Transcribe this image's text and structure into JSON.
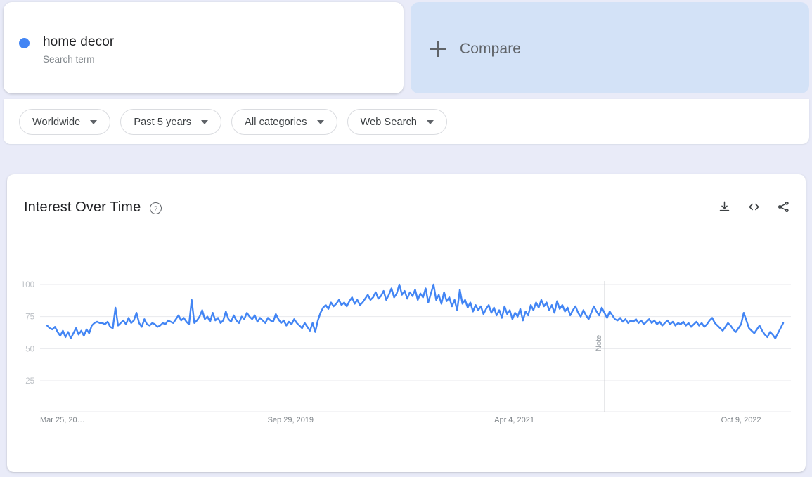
{
  "search_term_card": {
    "dot_color": "#4285f4",
    "term": "home decor",
    "subtitle": "Search term"
  },
  "compare_card": {
    "label": "Compare",
    "background": "#d3e2f7"
  },
  "filters": [
    {
      "label": "Worldwide"
    },
    {
      "label": "Past 5 years"
    },
    {
      "label": "All categories"
    },
    {
      "label": "Web Search"
    }
  ],
  "chart_panel": {
    "title": "Interest Over Time",
    "help_glyph": "?",
    "actions": [
      {
        "name": "download-icon"
      },
      {
        "name": "embed-icon"
      },
      {
        "name": "share-icon"
      }
    ]
  },
  "chart_data": {
    "type": "line",
    "title": "Interest Over Time",
    "xlabel": "",
    "ylabel": "",
    "ylim": [
      0,
      100
    ],
    "yticks": [
      25,
      50,
      75,
      100
    ],
    "ytick_labels": [
      "25",
      "50",
      "75",
      "100"
    ],
    "grid": true,
    "legend": false,
    "line_color": "#4285f4",
    "series_name": "home decor",
    "xtick_labels": [
      "Mar 25, 20…",
      "Sep 29, 2019",
      "Apr 4, 2021",
      "Oct 9, 2022"
    ],
    "xtick_positions_pct": [
      0.0,
      0.303,
      0.605,
      0.907
    ],
    "annotations": [
      {
        "type": "vertical-line",
        "label": "Note",
        "position_pct": 0.752
      }
    ],
    "values": [
      68,
      66,
      65,
      67,
      63,
      60,
      64,
      59,
      63,
      58,
      62,
      66,
      61,
      64,
      60,
      65,
      62,
      68,
      70,
      71,
      70,
      70,
      69,
      71,
      67,
      66,
      82,
      68,
      70,
      72,
      69,
      74,
      70,
      72,
      78,
      70,
      67,
      73,
      69,
      68,
      70,
      69,
      67,
      68,
      70,
      69,
      72,
      71,
      70,
      73,
      76,
      72,
      74,
      71,
      69,
      88,
      70,
      72,
      75,
      80,
      73,
      75,
      71,
      78,
      72,
      74,
      70,
      72,
      79,
      73,
      71,
      76,
      72,
      70,
      75,
      73,
      78,
      75,
      73,
      76,
      71,
      74,
      72,
      70,
      74,
      72,
      71,
      77,
      73,
      70,
      72,
      68,
      71,
      69,
      73,
      70,
      68,
      66,
      70,
      67,
      64,
      70,
      63,
      72,
      78,
      82,
      84,
      81,
      86,
      83,
      85,
      88,
      84,
      86,
      83,
      87,
      90,
      85,
      88,
      84,
      86,
      89,
      92,
      88,
      90,
      94,
      89,
      91,
      95,
      88,
      92,
      97,
      90,
      93,
      100,
      92,
      95,
      89,
      94,
      91,
      96,
      88,
      93,
      90,
      97,
      86,
      93,
      100,
      88,
      92,
      85,
      94,
      87,
      90,
      83,
      88,
      80,
      96,
      85,
      88,
      82,
      86,
      79,
      84,
      80,
      83,
      77,
      81,
      84,
      78,
      82,
      76,
      80,
      74,
      83,
      77,
      80,
      73,
      78,
      75,
      81,
      72,
      79,
      76,
      84,
      80,
      86,
      82,
      88,
      83,
      86,
      80,
      84,
      78,
      87,
      81,
      84,
      79,
      82,
      76,
      80,
      83,
      78,
      75,
      80,
      76,
      73,
      78,
      83,
      79,
      76,
      82,
      78,
      74,
      79,
      76,
      73,
      72,
      74,
      71,
      73,
      70,
      72,
      71,
      73,
      70,
      72,
      69,
      71,
      73,
      70,
      72,
      69,
      71,
      68,
      70,
      72,
      69,
      71,
      68,
      70,
      69,
      71,
      68,
      70,
      67,
      69,
      71,
      68,
      70,
      67,
      69,
      72,
      74,
      70,
      68,
      66,
      64,
      67,
      70,
      68,
      65,
      63,
      66,
      69,
      78,
      72,
      66,
      64,
      62,
      65,
      68,
      64,
      61,
      59,
      63,
      61,
      58,
      62,
      66,
      70
    ]
  }
}
